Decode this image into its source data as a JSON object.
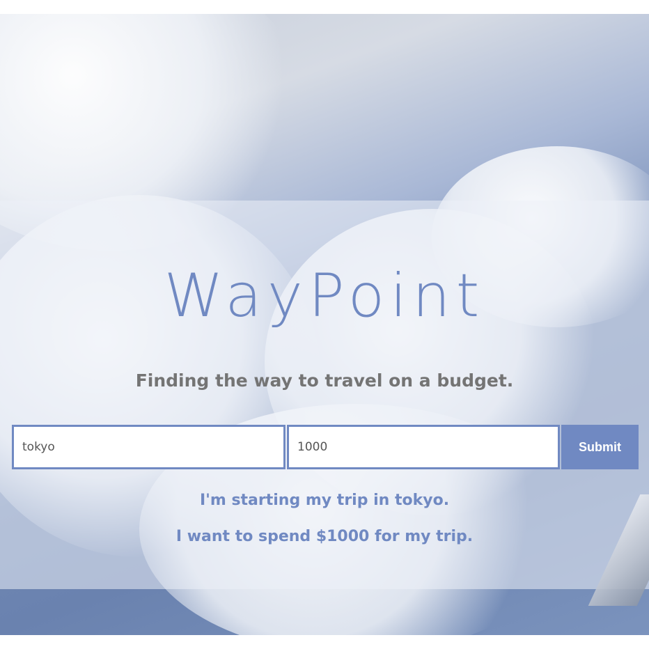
{
  "brand": {
    "title": "WayPoint",
    "tagline": "Finding the way to travel on a budget."
  },
  "search_form": {
    "start_city_value": "tokyo",
    "budget_value": "1000",
    "submit_label": "Submit"
  },
  "summary": {
    "start_line": "I'm starting my trip in tokyo.",
    "budget_line": "I want to spend $1000 for my trip."
  },
  "colors": {
    "accent": "#7089c2",
    "tagline": "#747474",
    "button_text": "#ffffff"
  }
}
